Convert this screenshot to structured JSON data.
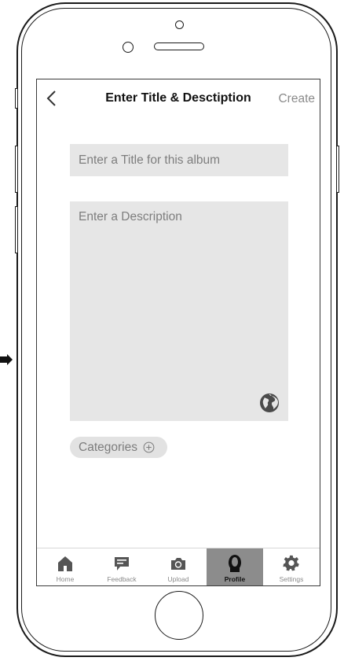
{
  "header": {
    "title": "Enter Title & Desctiption",
    "create_label": "Create",
    "back_icon": "chevron-left-icon"
  },
  "form": {
    "title_placeholder": "Enter a Title for this album",
    "title_value": "",
    "description_placeholder": "Enter a Description",
    "description_value": "",
    "globe_icon": "globe-icon",
    "categories_label": "Categories",
    "categories_icon": "plus-circle-icon"
  },
  "tabbar": {
    "items": [
      {
        "label": "Home",
        "icon": "home-icon"
      },
      {
        "label": "Feedback",
        "icon": "chat-icon"
      },
      {
        "label": "Upload",
        "icon": "camera-icon"
      },
      {
        "label": "Profile",
        "icon": "profile-icon",
        "active": true
      },
      {
        "label": "Settings",
        "icon": "gear-icon"
      }
    ]
  },
  "colors": {
    "field_bg": "#e6e6e6",
    "placeholder": "#7d7d7d",
    "active_tab_bg": "#8c8c8c",
    "icon_gray": "#555555"
  }
}
